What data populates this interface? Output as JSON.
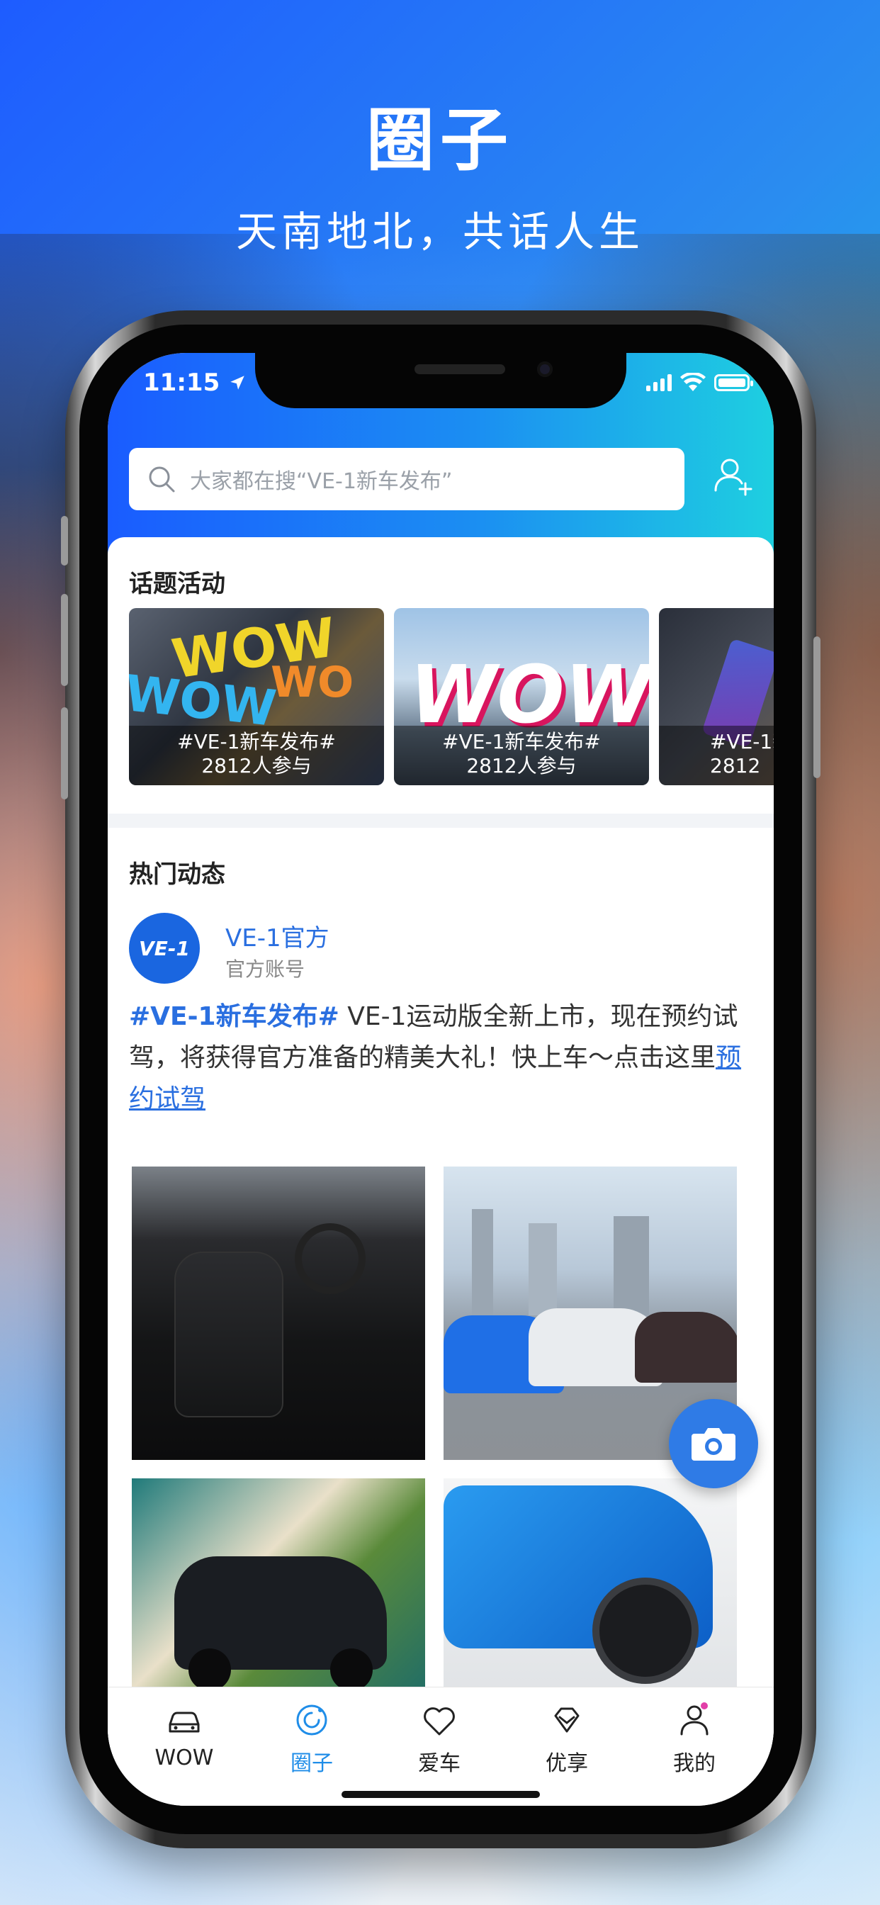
{
  "hero": {
    "title": "圈子",
    "subtitle": "天南地北，共话人生"
  },
  "status_bar": {
    "time": "11:15"
  },
  "search": {
    "placeholder": "大家都在搜“VE-1新车发布”"
  },
  "topics": {
    "section_title": "话题活动",
    "items": [
      {
        "tag": "#VE-1新车发布#",
        "participants": "2812人参与"
      },
      {
        "tag": "#VE-1新车发布#",
        "participants": "2812人参与"
      },
      {
        "tag": "#VE-1新",
        "participants": "2812"
      }
    ]
  },
  "feed": {
    "section_title": "热门动态",
    "post": {
      "avatar_text": "VE-1",
      "author": "VE-1官方",
      "author_tag": "官方账号",
      "hashtag": "#VE-1新车发布#",
      "body": "VE-1运动版全新上市，现在预约试驾，将获得官方准备的精美大礼！快上车～点击这里",
      "link_text": "预约试驾"
    }
  },
  "tabbar": {
    "items": [
      {
        "label": "WOW",
        "icon": "car-icon"
      },
      {
        "label": "圈子",
        "icon": "circle-icon"
      },
      {
        "label": "爱车",
        "icon": "heart-icon"
      },
      {
        "label": "优享",
        "icon": "diamond-icon"
      },
      {
        "label": "我的",
        "icon": "user-icon"
      }
    ],
    "active_index": 1
  },
  "colors": {
    "accent": "#2a6fe0",
    "tab_active": "#1f8de8",
    "header_gradient_start": "#1a5cff",
    "header_gradient_end": "#1ecfe0"
  }
}
